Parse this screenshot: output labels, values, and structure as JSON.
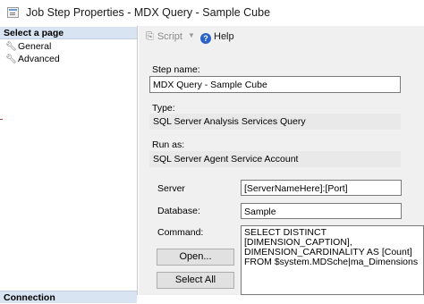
{
  "window": {
    "title": "Job Step Properties - MDX Query - Sample Cube"
  },
  "left_pane": {
    "select_page_header": "Select a page",
    "items": [
      {
        "label": "General",
        "icon": "wrench-icon"
      },
      {
        "label": "Advanced",
        "icon": "wrench-icon"
      }
    ],
    "connection_header": "Connection"
  },
  "toolbar": {
    "script_label": "Script",
    "help_label": "Help"
  },
  "form": {
    "step_name_label": "Step name:",
    "step_name_value": "MDX Query - Sample Cube",
    "type_label": "Type:",
    "type_value": "SQL Server Analysis Services Query",
    "run_as_label": "Run as:",
    "run_as_value": "SQL Server Agent Service Account",
    "server_label": "Server",
    "server_value": "[ServerNameHere]:[Port]",
    "database_label": "Database:",
    "database_value": "Sample",
    "command_label": "Command:",
    "command_lines": [
      "SELECT DISTINCT",
      "[DIMENSION_CAPTION],",
      "DIMENSION_CARDINALITY AS [Count]",
      "FROM $system.MDSche|ma_Dimensions"
    ],
    "open_button": "Open...",
    "select_all_button": "Select All"
  }
}
